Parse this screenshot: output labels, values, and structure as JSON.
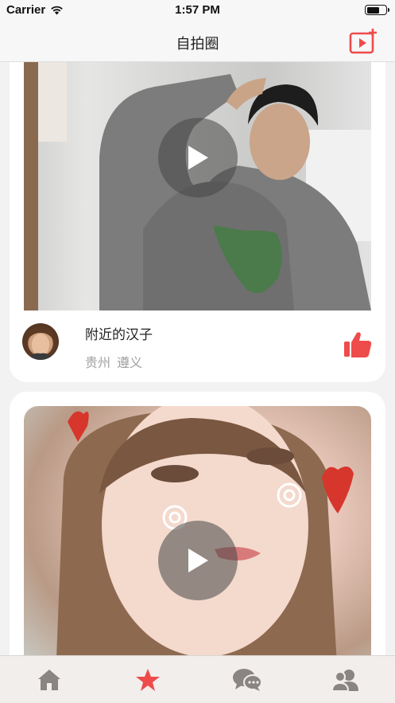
{
  "status_bar": {
    "carrier": "Carrier",
    "time": "1:57 PM"
  },
  "nav": {
    "title": "自拍圈"
  },
  "posts": [
    {
      "name": "附近的汉子",
      "province": "贵州",
      "city": "遵义"
    }
  ],
  "tabs": [
    {
      "icon": "home-icon",
      "active": false
    },
    {
      "icon": "star-icon",
      "active": true
    },
    {
      "icon": "chat-icon",
      "active": false
    },
    {
      "icon": "contacts-icon",
      "active": false
    }
  ],
  "colors": {
    "accent": "#ee4b4b",
    "tab_inactive": "#8a8583",
    "location_gray": "#a0a0a0"
  }
}
